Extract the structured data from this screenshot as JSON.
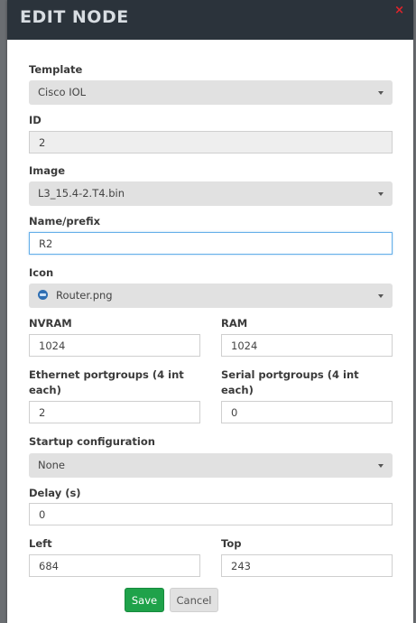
{
  "dialog": {
    "title": "EDIT NODE",
    "close_label": "×"
  },
  "form": {
    "template": {
      "label": "Template",
      "value": "Cisco IOL"
    },
    "id": {
      "label": "ID",
      "value": "2"
    },
    "image": {
      "label": "Image",
      "value": "L3_15.4-2.T4.bin"
    },
    "name": {
      "label": "Name/prefix",
      "value": "R2"
    },
    "icon": {
      "label": "Icon",
      "value": "Router.png",
      "icon_name": "router-icon"
    },
    "nvram": {
      "label": "NVRAM",
      "value": "1024"
    },
    "ram": {
      "label": "RAM",
      "value": "1024"
    },
    "ethernet": {
      "label": "Ethernet portgroups (4 int each)",
      "value": "2"
    },
    "serial": {
      "label": "Serial portgroups (4 int each)",
      "value": "0"
    },
    "startup": {
      "label": "Startup configuration",
      "value": "None"
    },
    "delay": {
      "label": "Delay (s)",
      "value": "0"
    },
    "left": {
      "label": "Left",
      "value": "684"
    },
    "top": {
      "label": "Top",
      "value": "243"
    }
  },
  "buttons": {
    "save": "Save",
    "cancel": "Cancel"
  },
  "colors": {
    "header": "#2b333b",
    "save": "#1fa24a",
    "close": "#e0242b",
    "focus": "#66afe9"
  }
}
